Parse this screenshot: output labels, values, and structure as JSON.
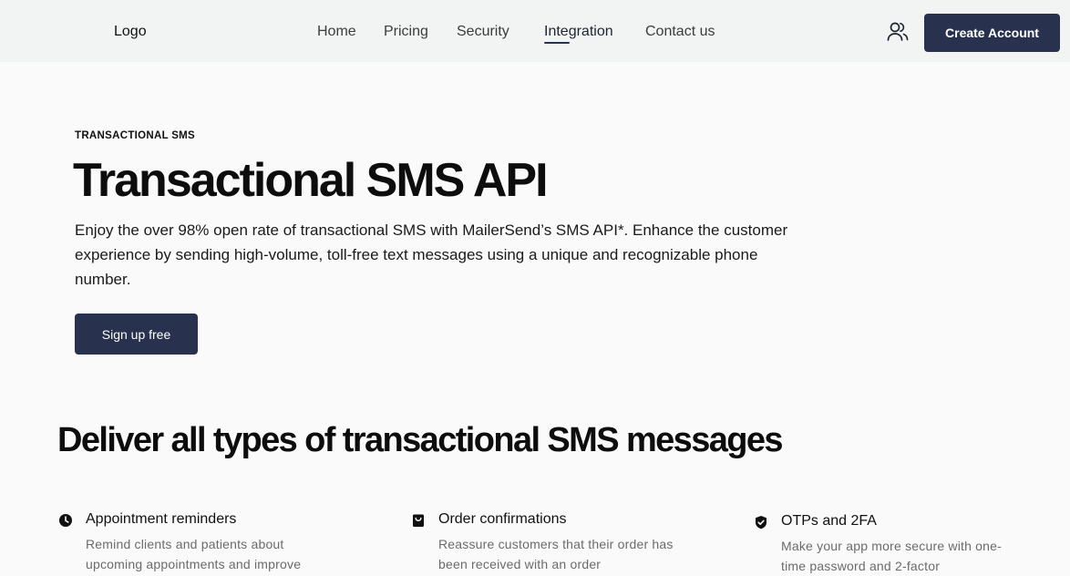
{
  "nav": {
    "logo": "Logo",
    "links": [
      {
        "label": "Home"
      },
      {
        "label": "Pricing"
      },
      {
        "label": "Security"
      },
      {
        "label": "Integration",
        "active": true
      },
      {
        "label": "Contact us"
      }
    ],
    "user_icon": "users-icon",
    "cta_label": "Create Account"
  },
  "hero": {
    "eyebrow": "TRANSACTIONAL SMS",
    "title": "Transactional SMS API",
    "description": "Enjoy the over 98% open rate of transactional SMS with MailerSend’s SMS API*. Enhance the customer experience by sending high-volume, toll-free text messages using a unique and recognizable phone number.",
    "cta_label": "Sign up free"
  },
  "section": {
    "title": "Deliver all types of transactional SMS messages",
    "features": [
      {
        "icon": "clock-icon",
        "title": "Appointment reminders",
        "description": "Remind clients and patients about upcoming appointments and improve"
      },
      {
        "icon": "shopping-bag-icon",
        "title": "Order confirmations",
        "description": "Reassure customers that their order has been received with an order"
      },
      {
        "icon": "shield-check-icon",
        "title": "OTPs and 2FA",
        "description": "Make your app more secure with one-time password and 2-factor"
      }
    ]
  },
  "colors": {
    "primary": "#28324f",
    "nav_bg": "#f1f4f2",
    "page_bg": "#fafafa"
  }
}
